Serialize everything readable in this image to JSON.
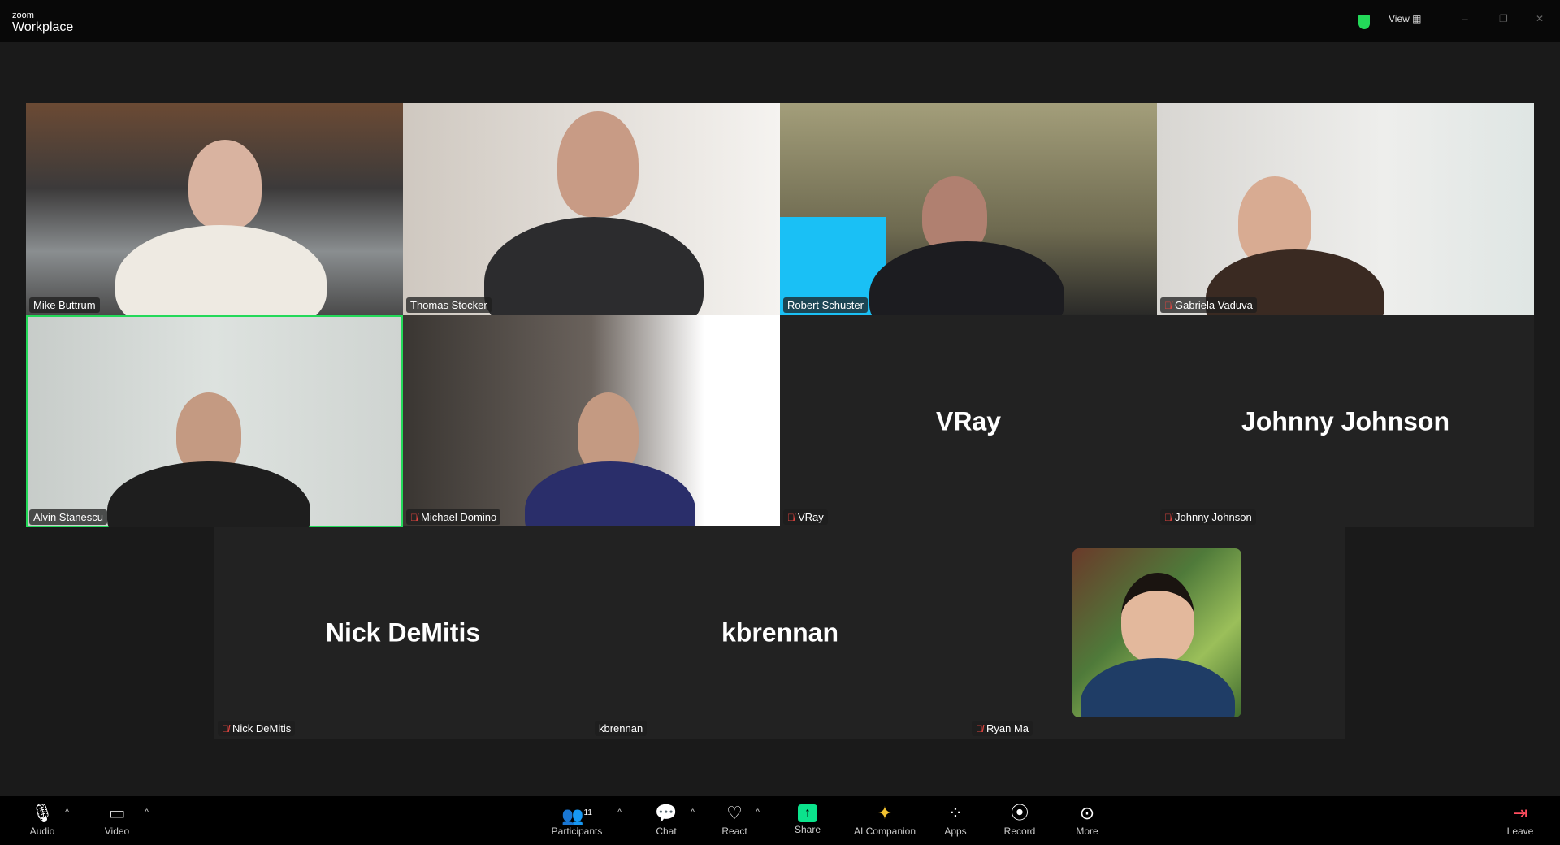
{
  "window": {
    "brand_small": "zoom",
    "brand": "Workplace",
    "view_label": "View",
    "colors": {
      "accent": "#23d959",
      "mute": "#e0443f",
      "share": "#0be38c"
    }
  },
  "tiles": [
    {
      "name": "Mike Buttrum",
      "muted": false,
      "video": true
    },
    {
      "name": "Thomas Stocker",
      "muted": false,
      "video": true
    },
    {
      "name": "Robert Schuster",
      "muted": false,
      "video": true
    },
    {
      "name": "Gabriela Vaduva",
      "muted": true,
      "video": true
    },
    {
      "name": "Alvin Stanescu",
      "muted": false,
      "video": true,
      "active": true
    },
    {
      "name": "Michael Domino",
      "muted": true,
      "video": true
    },
    {
      "name": "VRay",
      "muted": true,
      "video": false,
      "display": "VRay"
    },
    {
      "name": "Johnny Johnson",
      "muted": true,
      "video": false,
      "display": "Johnny Johnson"
    },
    {
      "name": "Nick DeMitis",
      "muted": true,
      "video": false,
      "display": "Nick DeMitis"
    },
    {
      "name": "kbrennan",
      "muted": false,
      "video": false,
      "display": "kbrennan"
    },
    {
      "name": "Ryan Ma",
      "muted": true,
      "video": false,
      "avatar": true
    }
  ],
  "toolbar": {
    "audio": "Audio",
    "video": "Video",
    "participants": "Participants",
    "participants_count": "11",
    "chat": "Chat",
    "react": "React",
    "share": "Share",
    "ai": "AI Companion",
    "apps": "Apps",
    "record": "Record",
    "more": "More",
    "leave": "Leave"
  }
}
